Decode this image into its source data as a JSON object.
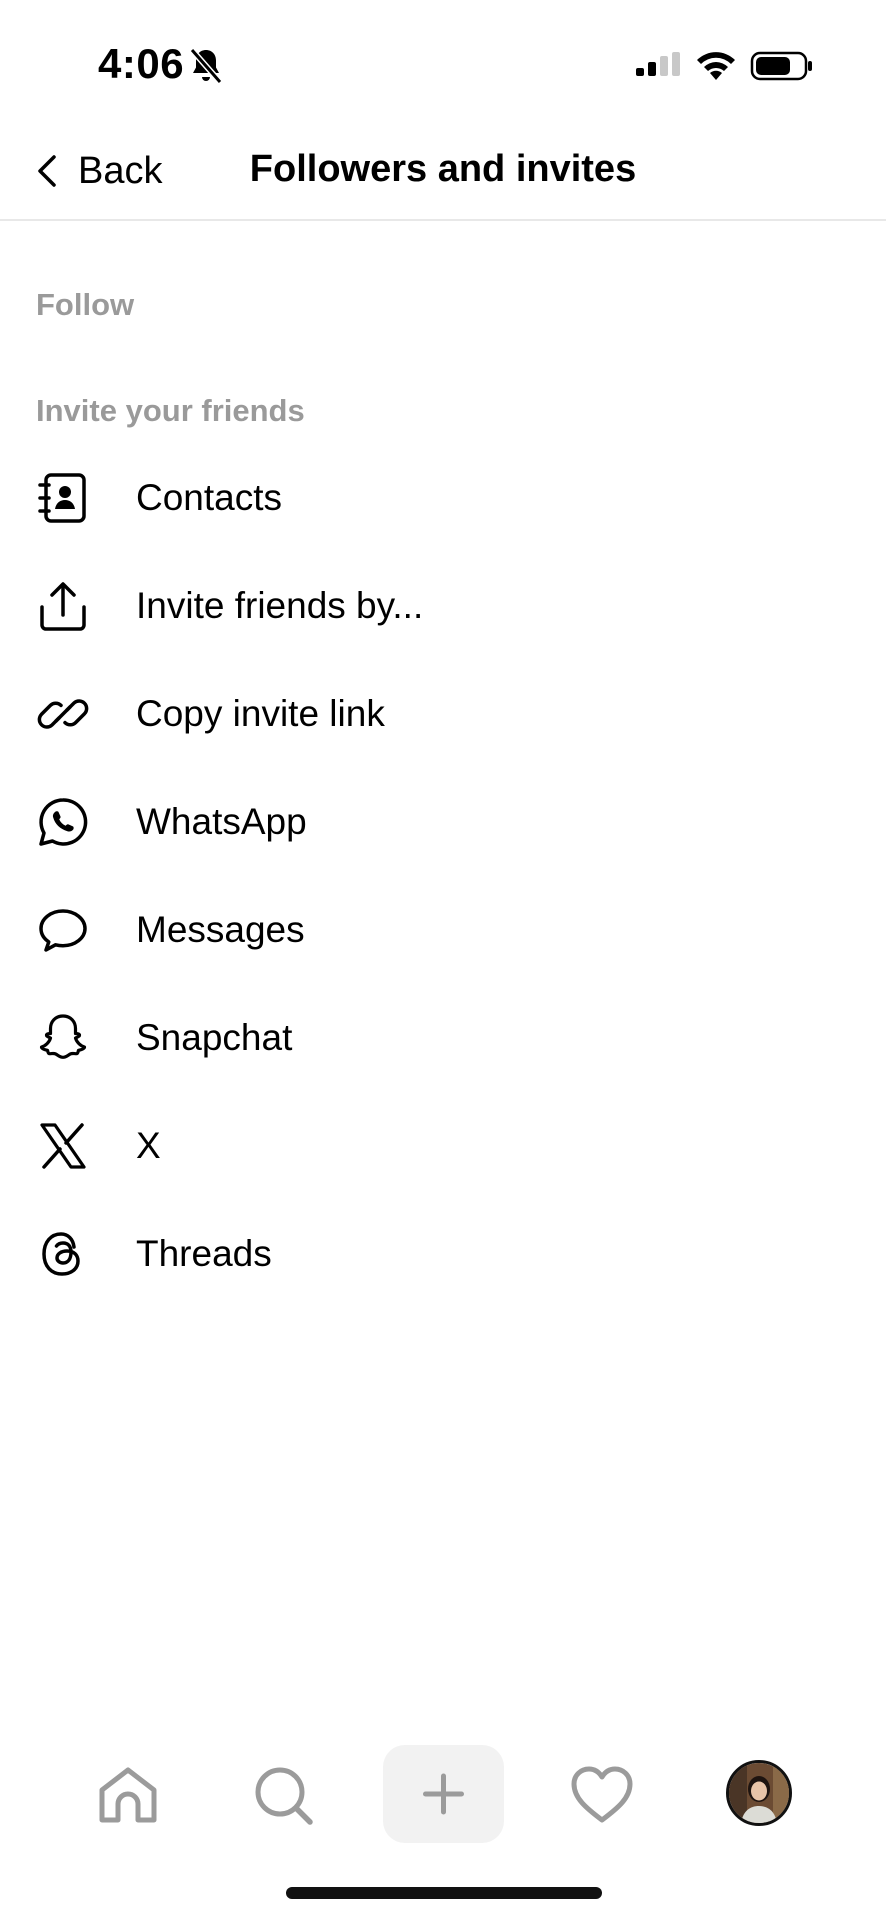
{
  "status_bar": {
    "time": "4:06",
    "icons": [
      "bell-slash-icon",
      "cellular-signal-icon",
      "wifi-icon",
      "battery-icon"
    ]
  },
  "header": {
    "back_label": "Back",
    "title": "Followers and invites"
  },
  "sections": {
    "follow_label": "Follow",
    "invite_label": "Invite your friends"
  },
  "invite_items": [
    {
      "label": "Contacts",
      "icon": "contacts-book-icon"
    },
    {
      "label": "Invite friends by...",
      "icon": "share-upload-icon"
    },
    {
      "label": "Copy invite link",
      "icon": "link-icon"
    },
    {
      "label": "WhatsApp",
      "icon": "whatsapp-icon"
    },
    {
      "label": "Messages",
      "icon": "message-bubble-icon"
    },
    {
      "label": "Snapchat",
      "icon": "snapchat-ghost-icon"
    },
    {
      "label": "X",
      "icon": "x-logo-icon"
    },
    {
      "label": "Threads",
      "icon": "threads-logo-icon"
    }
  ],
  "bottom_nav": {
    "items": [
      "home-icon",
      "search-icon",
      "plus-icon",
      "heart-icon",
      "profile-avatar"
    ]
  },
  "colors": {
    "section_label": "#9a9a9a",
    "divider": "#e8e8e8",
    "nav_icon": "#9b9b9b",
    "new_post_bg": "#f2f2f2"
  }
}
